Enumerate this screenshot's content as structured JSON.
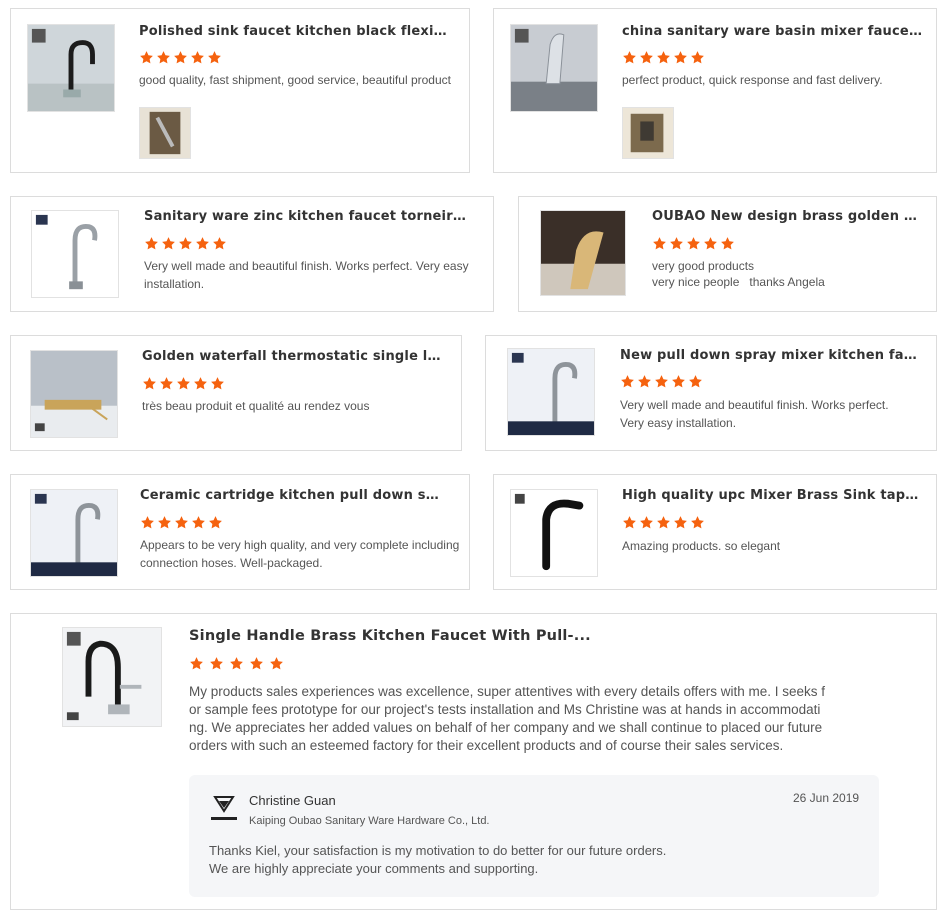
{
  "reviews": [
    {
      "title": "Polished sink faucet kitchen black flexible hos...",
      "rating": 5,
      "text": "good quality, fast shipment, good service, beautiful product"
    },
    {
      "title": "china sanitary ware basin mixer faucet bathroo...",
      "rating": 5,
      "text": "perfect product, quick response and fast delivery."
    },
    {
      "title": "Sanitary ware zinc kitchen faucet torneiras importada...",
      "rating": 5,
      "text_lines": [
        "Very well made and beautiful finish. Works perfect. Very easy",
        "installation."
      ]
    },
    {
      "title": "OUBAO New design brass golden mixer t ...",
      "rating": 5,
      "text_lines": [
        "very good products",
        "very nice people   thanks Angela"
      ]
    },
    {
      "title": "Golden waterfall thermostatic single lever bathtub sh...",
      "rating": 5,
      "text": "très beau produit et qualité au rendez vous"
    },
    {
      "title": "New pull down spray mixer kitchen faucet robl...",
      "rating": 5,
      "text_lines": [
        "Very well made and beautiful finish. Works perfect.",
        "Very easy installation."
      ]
    },
    {
      "title": "Ceramic cartridge kitchen pull down sink mixer...",
      "rating": 5,
      "text_lines": [
        "Appears to be very high quality, and very complete including",
        "connection hoses. Well-packaged."
      ]
    },
    {
      "title": "High quality upc Mixer Brass Sink tap black pul...",
      "rating": 5,
      "text": "Amazing products. so elegant"
    }
  ],
  "featured": {
    "title": "Single Handle Brass Kitchen Faucet With Pull-...",
    "rating": 5,
    "text_lines": [
      "My products sales experiences was excellence, super attentives with every details offers with me. I seeks f",
      "or sample fees prototype for our project's tests installation and Ms Christine was at hands in accommodati",
      "ng. We appreciates her added values on behalf of her company and we shall continue to placed our future",
      "orders with such an esteemed factory for their excellent products and of course their sales services."
    ],
    "reply": {
      "name": "Christine Guan",
      "date": "26 Jun 2019",
      "company": "Kaiping Oubao Sanitary Ware Hardware Co., Ltd.",
      "text_lines": [
        "Thanks Kiel, your satisfaction is my motivation to do better for our future orders.",
        "We are highly appreciate your comments and supporting."
      ]
    }
  },
  "colors": {
    "star": "#f5620f",
    "border": "#dcdcdc",
    "reply_bg": "#f5f6f8"
  },
  "icons": {
    "star": "star-icon",
    "logo": "oubao-logo-icon"
  }
}
